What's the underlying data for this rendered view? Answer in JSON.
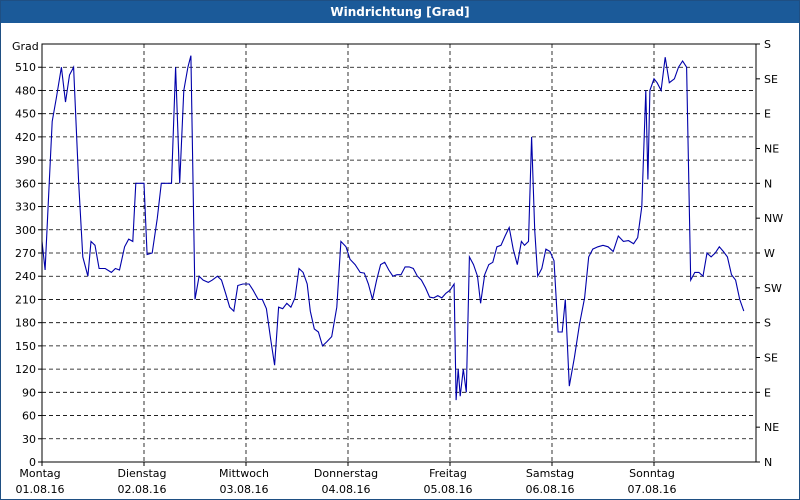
{
  "window": {
    "title": "Windrichtung [Grad]"
  },
  "chart_data": {
    "type": "line",
    "title": "Windrichtung [Grad]",
    "ylabel": "Grad",
    "ylim": [
      0,
      540
    ],
    "xlim_days": [
      0,
      7
    ],
    "y_ticks": [
      0,
      30,
      60,
      90,
      120,
      150,
      180,
      210,
      240,
      270,
      300,
      330,
      360,
      390,
      420,
      450,
      480,
      510
    ],
    "y_tick_labels": [
      "0",
      "30",
      "60",
      "90",
      "120",
      "150",
      "180",
      "210",
      "240",
      "270",
      "300",
      "330",
      "360",
      "390",
      "420",
      "450",
      "480",
      "510"
    ],
    "right_ticks": [
      {
        "value": 0,
        "label": "N"
      },
      {
        "value": 45,
        "label": "NE"
      },
      {
        "value": 90,
        "label": "E"
      },
      {
        "value": 135,
        "label": "SE"
      },
      {
        "value": 180,
        "label": "S"
      },
      {
        "value": 225,
        "label": "SW"
      },
      {
        "value": 270,
        "label": "W"
      },
      {
        "value": 315,
        "label": "NW"
      },
      {
        "value": 360,
        "label": "N"
      },
      {
        "value": 405,
        "label": "NE"
      },
      {
        "value": 450,
        "label": "E"
      },
      {
        "value": 495,
        "label": "SE"
      },
      {
        "value": 540,
        "label": "S"
      }
    ],
    "x_ticks": [
      {
        "day": 0,
        "weekday": "Montag",
        "date": "01.08.16"
      },
      {
        "day": 1,
        "weekday": "Dienstag",
        "date": "02.08.16"
      },
      {
        "day": 2,
        "weekday": "Mittwoch",
        "date": "03.08.16"
      },
      {
        "day": 3,
        "weekday": "Donnerstag",
        "date": "04.08.16"
      },
      {
        "day": 4,
        "weekday": "Freitag",
        "date": "05.08.16"
      },
      {
        "day": 5,
        "weekday": "Samstag",
        "date": "06.08.16"
      },
      {
        "day": 6,
        "weekday": "Sonntag",
        "date": "07.08.16"
      }
    ],
    "grid": true,
    "line_color": "#0000aa",
    "series": [
      {
        "values": [
          [
            0.0,
            285
          ],
          [
            0.03,
            248
          ],
          [
            0.06,
            330
          ],
          [
            0.1,
            440
          ],
          [
            0.14,
            470
          ],
          [
            0.19,
            510
          ],
          [
            0.23,
            465
          ],
          [
            0.27,
            500
          ],
          [
            0.31,
            510
          ],
          [
            0.36,
            360
          ],
          [
            0.4,
            265
          ],
          [
            0.45,
            240
          ],
          [
            0.48,
            285
          ],
          [
            0.52,
            280
          ],
          [
            0.56,
            250
          ],
          [
            0.62,
            250
          ],
          [
            0.68,
            245
          ],
          [
            0.72,
            250
          ],
          [
            0.76,
            248
          ],
          [
            0.81,
            278
          ],
          [
            0.85,
            288
          ],
          [
            0.89,
            285
          ],
          [
            0.92,
            360
          ],
          [
            1.0,
            360
          ],
          [
            1.03,
            268
          ],
          [
            1.08,
            270
          ],
          [
            1.13,
            315
          ],
          [
            1.17,
            360
          ],
          [
            1.23,
            360
          ],
          [
            1.27,
            360
          ],
          [
            1.31,
            510
          ],
          [
            1.35,
            360
          ],
          [
            1.39,
            480
          ],
          [
            1.43,
            510
          ],
          [
            1.46,
            525
          ],
          [
            1.5,
            210
          ],
          [
            1.54,
            240
          ],
          [
            1.58,
            235
          ],
          [
            1.63,
            232
          ],
          [
            1.67,
            235
          ],
          [
            1.72,
            240
          ],
          [
            1.76,
            235
          ],
          [
            1.8,
            218
          ],
          [
            1.84,
            200
          ],
          [
            1.88,
            195
          ],
          [
            1.92,
            228
          ],
          [
            1.97,
            230
          ],
          [
            2.03,
            230
          ],
          [
            2.07,
            222
          ],
          [
            2.12,
            210
          ],
          [
            2.16,
            210
          ],
          [
            2.2,
            198
          ],
          [
            2.24,
            160
          ],
          [
            2.28,
            125
          ],
          [
            2.32,
            200
          ],
          [
            2.36,
            198
          ],
          [
            2.4,
            205
          ],
          [
            2.44,
            200
          ],
          [
            2.48,
            212
          ],
          [
            2.52,
            250
          ],
          [
            2.56,
            245
          ],
          [
            2.6,
            230
          ],
          [
            2.63,
            195
          ],
          [
            2.67,
            172
          ],
          [
            2.71,
            168
          ],
          [
            2.75,
            150
          ],
          [
            2.79,
            155
          ],
          [
            2.84,
            162
          ],
          [
            2.89,
            200
          ],
          [
            2.93,
            285
          ],
          [
            2.98,
            278
          ],
          [
            3.02,
            262
          ],
          [
            3.07,
            255
          ],
          [
            3.12,
            245
          ],
          [
            3.16,
            244
          ],
          [
            3.2,
            230
          ],
          [
            3.24,
            210
          ],
          [
            3.28,
            235
          ],
          [
            3.32,
            255
          ],
          [
            3.36,
            258
          ],
          [
            3.4,
            248
          ],
          [
            3.44,
            240
          ],
          [
            3.48,
            242
          ],
          [
            3.52,
            242
          ],
          [
            3.56,
            252
          ],
          [
            3.6,
            252
          ],
          [
            3.64,
            250
          ],
          [
            3.68,
            240
          ],
          [
            3.72,
            235
          ],
          [
            3.76,
            225
          ],
          [
            3.8,
            213
          ],
          [
            3.84,
            212
          ],
          [
            3.88,
            215
          ],
          [
            3.92,
            212
          ],
          [
            3.96,
            218
          ],
          [
            4.0,
            222
          ],
          [
            4.04,
            230
          ],
          [
            4.06,
            80
          ],
          [
            4.08,
            120
          ],
          [
            4.1,
            85
          ],
          [
            4.13,
            120
          ],
          [
            4.16,
            90
          ],
          [
            4.19,
            265
          ],
          [
            4.23,
            255
          ],
          [
            4.27,
            240
          ],
          [
            4.3,
            205
          ],
          [
            4.34,
            242
          ],
          [
            4.38,
            255
          ],
          [
            4.42,
            258
          ],
          [
            4.46,
            278
          ],
          [
            4.5,
            280
          ],
          [
            4.54,
            292
          ],
          [
            4.58,
            303
          ],
          [
            4.62,
            275
          ],
          [
            4.66,
            255
          ],
          [
            4.7,
            285
          ],
          [
            4.73,
            280
          ],
          [
            4.77,
            285
          ],
          [
            4.8,
            420
          ],
          [
            4.83,
            300
          ],
          [
            4.86,
            240
          ],
          [
            4.9,
            250
          ],
          [
            4.94,
            275
          ],
          [
            4.98,
            272
          ],
          [
            5.02,
            260
          ],
          [
            5.06,
            168
          ],
          [
            5.1,
            168
          ],
          [
            5.13,
            210
          ],
          [
            5.17,
            98
          ],
          [
            5.22,
            135
          ],
          [
            5.27,
            178
          ],
          [
            5.32,
            212
          ],
          [
            5.36,
            265
          ],
          [
            5.4,
            275
          ],
          [
            5.45,
            278
          ],
          [
            5.5,
            280
          ],
          [
            5.55,
            278
          ],
          [
            5.6,
            272
          ],
          [
            5.65,
            292
          ],
          [
            5.7,
            285
          ],
          [
            5.75,
            286
          ],
          [
            5.8,
            282
          ],
          [
            5.84,
            290
          ],
          [
            5.88,
            330
          ],
          [
            5.92,
            480
          ],
          [
            5.94,
            365
          ],
          [
            5.96,
            480
          ],
          [
            6.0,
            495
          ],
          [
            6.03,
            490
          ],
          [
            6.07,
            480
          ],
          [
            6.11,
            523
          ],
          [
            6.15,
            490
          ],
          [
            6.2,
            495
          ],
          [
            6.24,
            510
          ],
          [
            6.28,
            518
          ],
          [
            6.32,
            510
          ],
          [
            6.36,
            235
          ],
          [
            6.4,
            245
          ],
          [
            6.44,
            245
          ],
          [
            6.48,
            240
          ],
          [
            6.52,
            270
          ],
          [
            6.56,
            265
          ],
          [
            6.6,
            270
          ],
          [
            6.64,
            278
          ],
          [
            6.68,
            272
          ],
          [
            6.72,
            265
          ],
          [
            6.76,
            242
          ],
          [
            6.8,
            235
          ],
          [
            6.84,
            210
          ],
          [
            6.88,
            195
          ]
        ]
      }
    ]
  }
}
